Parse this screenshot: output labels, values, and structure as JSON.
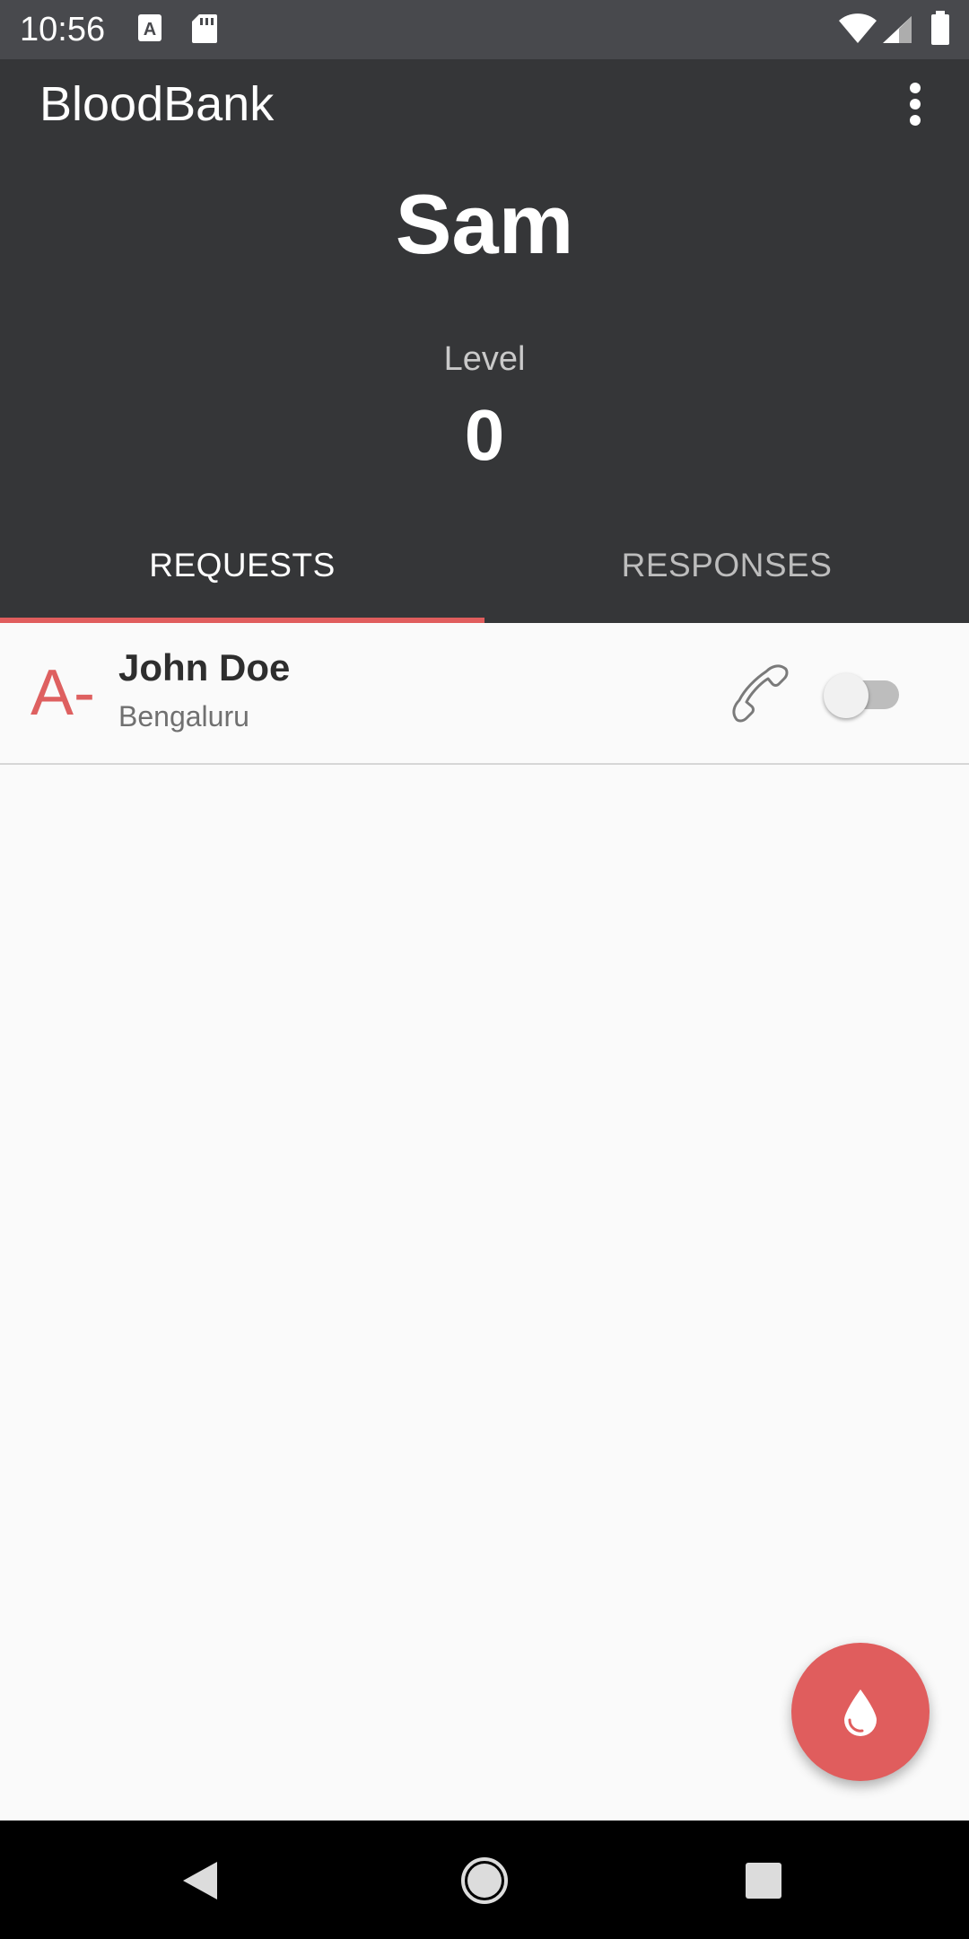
{
  "status_bar": {
    "time": "10:56",
    "left_icons": [
      "a-notification-icon",
      "sd-card-icon"
    ],
    "right_icons": [
      "wifi-icon",
      "cell-signal-icon",
      "battery-icon"
    ]
  },
  "app_bar": {
    "title": "BloodBank",
    "menu_icon": "overflow-menu-icon"
  },
  "profile": {
    "name": "Sam",
    "level_label": "Level",
    "level_value": "0"
  },
  "tabs": [
    {
      "label": "REQUESTS",
      "selected": true
    },
    {
      "label": "RESPONSES",
      "selected": false
    }
  ],
  "requests": [
    {
      "blood_type": "A-",
      "name": "John Doe",
      "city": "Bengaluru",
      "call_icon": "phone-icon",
      "toggle_on": false
    }
  ],
  "fab": {
    "icon": "blood-drop-icon"
  },
  "nav_bar": {
    "icons": [
      "back-icon",
      "home-icon",
      "recents-icon"
    ]
  },
  "colors": {
    "accent": "#e05d5d",
    "app_bar": "#353638",
    "status_bar": "#48494d"
  }
}
